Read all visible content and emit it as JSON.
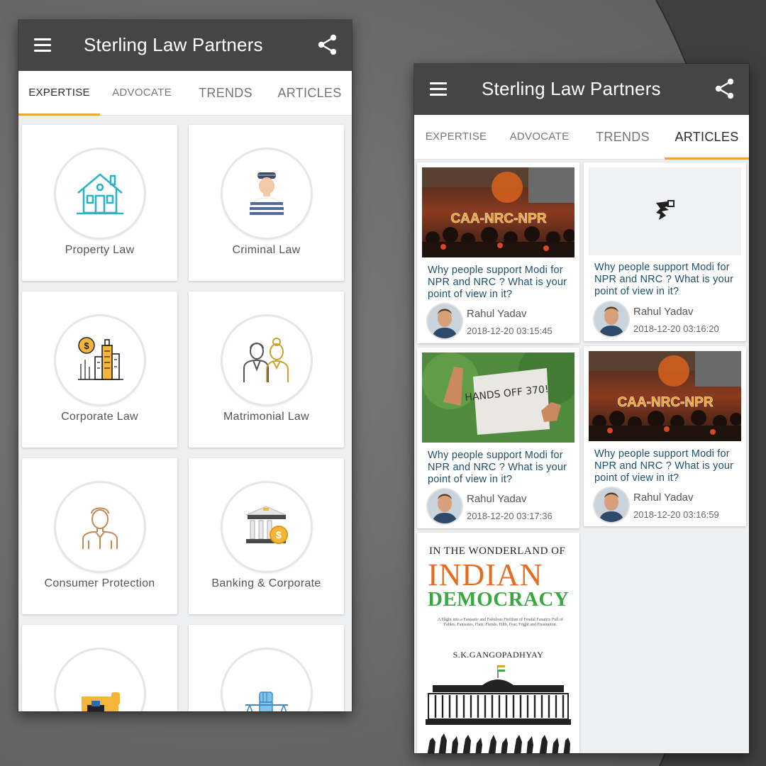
{
  "app": {
    "title": "Sterling Law Partners",
    "tabs": [
      "EXPERTISE",
      "ADVOCATE",
      "TRENDS",
      "ARTICLES"
    ]
  },
  "expertise": {
    "items": [
      {
        "label": "Property Law",
        "icon": "house-icon"
      },
      {
        "label": "Criminal Law",
        "icon": "prisoner-icon"
      },
      {
        "label": "Corporate Law",
        "icon": "corporate-building-icon"
      },
      {
        "label": "Matrimonial Law",
        "icon": "couple-icon"
      },
      {
        "label": "Consumer Protection",
        "icon": "consumer-person-icon"
      },
      {
        "label": "Banking & Corporate",
        "icon": "bank-icon"
      },
      {
        "label": "",
        "icon": "document-icon"
      },
      {
        "label": "",
        "icon": "scales-fist-icon"
      }
    ]
  },
  "articles": {
    "items": [
      {
        "title": "Why people support Modi for NPR and NRC ? What is your point of view in it?",
        "author": "Rahul Yadav",
        "date": "2018-12-20 03:15:45",
        "image_text": "CAA-NRC-NPR"
      },
      {
        "title": "Why people support Modi for NPR and NRC ? What is your point of view in it?",
        "author": "Rahul Yadav",
        "date": "2018-12-20 03:16:20",
        "image_text": ""
      },
      {
        "title": "Why people support Modi for NPR and NRC ? What is your point of view in it?",
        "author": "Rahul Yadav",
        "date": "2018-12-20 03:17:36",
        "image_text": "HANDS OFF 370!"
      },
      {
        "title": "Why people support Modi for NPR and NRC ? What is your point of view in it?",
        "author": "Rahul Yadav",
        "date": "2018-12-20 03:16:59",
        "image_text": "CAA-NRC-NPR"
      }
    ],
    "book": {
      "top": "IN THE WONDERLAND OF",
      "main": "INDIAN",
      "sub": "DEMOCRACY",
      "fine": "A Flight into a Fantastic and Fabulous Fiefdom of Feudal Fanatics Full of Fables, Fantasies, Fiats, Fiends, Filth, Fear, Fright and Frustration.",
      "author": "S.K.GANGOPADHYAY"
    }
  },
  "colors": {
    "appbar": "#454545",
    "tab_indicator": "#f2a33a",
    "article_title": "#1d4f6a"
  }
}
